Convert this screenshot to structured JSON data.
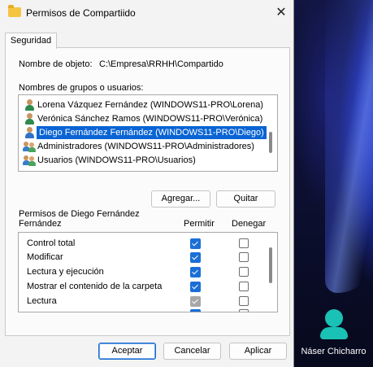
{
  "window": {
    "title": "Permisos de Compartiido",
    "close_glyph": "✕"
  },
  "tab": {
    "label": "Seguridad"
  },
  "object": {
    "label": "Nombre de objeto:",
    "value": "C:\\Empresa\\RRHH\\Compartido"
  },
  "groups": {
    "label": "Nombres de grupos o usuarios:",
    "items": [
      {
        "label": "Lorena Vázquez Fernández (WINDOWS11-PRO\\Lorena)",
        "icon": "user-icon",
        "selected": false
      },
      {
        "label": "Verónica Sánchez Ramos (WINDOWS11-PRO\\Verónica)",
        "icon": "user-icon",
        "selected": false
      },
      {
        "label": "Diego Fernández Fernández (WINDOWS11-PRO\\Diego)",
        "icon": "user-icon",
        "selected": true
      },
      {
        "label": "Administradores (WINDOWS11-PRO\\Administradores)",
        "icon": "group-icon",
        "selected": false
      },
      {
        "label": "Usuarios (WINDOWS11-PRO\\Usuarios)",
        "icon": "group-icon",
        "selected": false
      }
    ]
  },
  "buttons": {
    "add": "Agregar...",
    "remove": "Quitar",
    "ok": "Aceptar",
    "cancel": "Cancelar",
    "apply": "Aplicar"
  },
  "permissions": {
    "title": "Permisos de Diego Fernández Fernández",
    "allow_header": "Permitir",
    "deny_header": "Denegar",
    "rows": [
      {
        "label": "Control total",
        "allow": true,
        "allow_disabled": false,
        "deny": false
      },
      {
        "label": "Modificar",
        "allow": true,
        "allow_disabled": false,
        "deny": false
      },
      {
        "label": "Lectura y ejecución",
        "allow": true,
        "allow_disabled": false,
        "deny": false
      },
      {
        "label": "Mostrar el contenido de la carpeta",
        "allow": true,
        "allow_disabled": false,
        "deny": false
      },
      {
        "label": "Lectura",
        "allow": true,
        "allow_disabled": true,
        "deny": false
      }
    ]
  },
  "desktop_user": {
    "name": "Náser Chicharro",
    "avatar_color": "#19c2b4"
  },
  "colors": {
    "selection": "#0a64d4",
    "checkbox_on": "#1a6fd6"
  }
}
